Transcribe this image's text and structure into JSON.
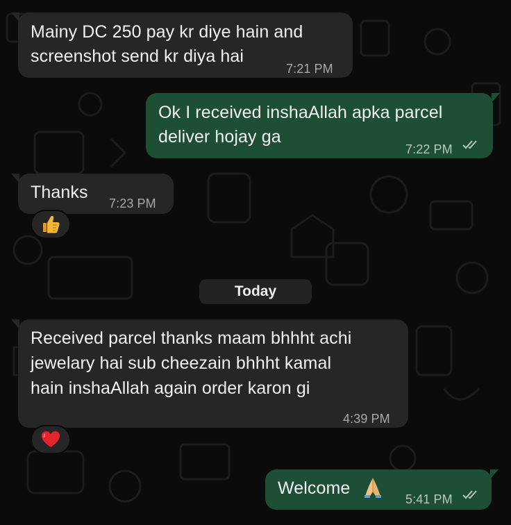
{
  "chat": {
    "date_separator": "Today",
    "messages": [
      {
        "direction": "incoming",
        "lines": [
          "Mainy DC 250 pay kr diye hain and",
          "screenshot send kr diya hai"
        ],
        "time": "7:21 PM"
      },
      {
        "direction": "outgoing",
        "lines": [
          "Ok I received inshaAllah apka parcel",
          "deliver hojay ga"
        ],
        "time": "7:22 PM",
        "status": "read"
      },
      {
        "direction": "incoming",
        "lines": [
          "Thanks"
        ],
        "time": "7:23 PM",
        "reaction": "thumbs-up-emoji"
      },
      {
        "direction": "incoming",
        "lines": [
          "Received parcel thanks maam bhhht achi",
          "jewelary hai sub cheezain bhhht kamal",
          "hain inshaAllah again order karon gi"
        ],
        "time": "4:39 PM",
        "reaction": "red-heart-emoji"
      },
      {
        "direction": "outgoing",
        "lines": [
          "Welcome"
        ],
        "emoji": "folded-hands-emoji",
        "time": "5:41 PM",
        "status": "read"
      }
    ]
  },
  "colors": {
    "background": "#0b0b0b",
    "incoming_bubble": "#262626",
    "outgoing_bubble": "#1d4f36",
    "read_ticks": "#b6c9be"
  }
}
